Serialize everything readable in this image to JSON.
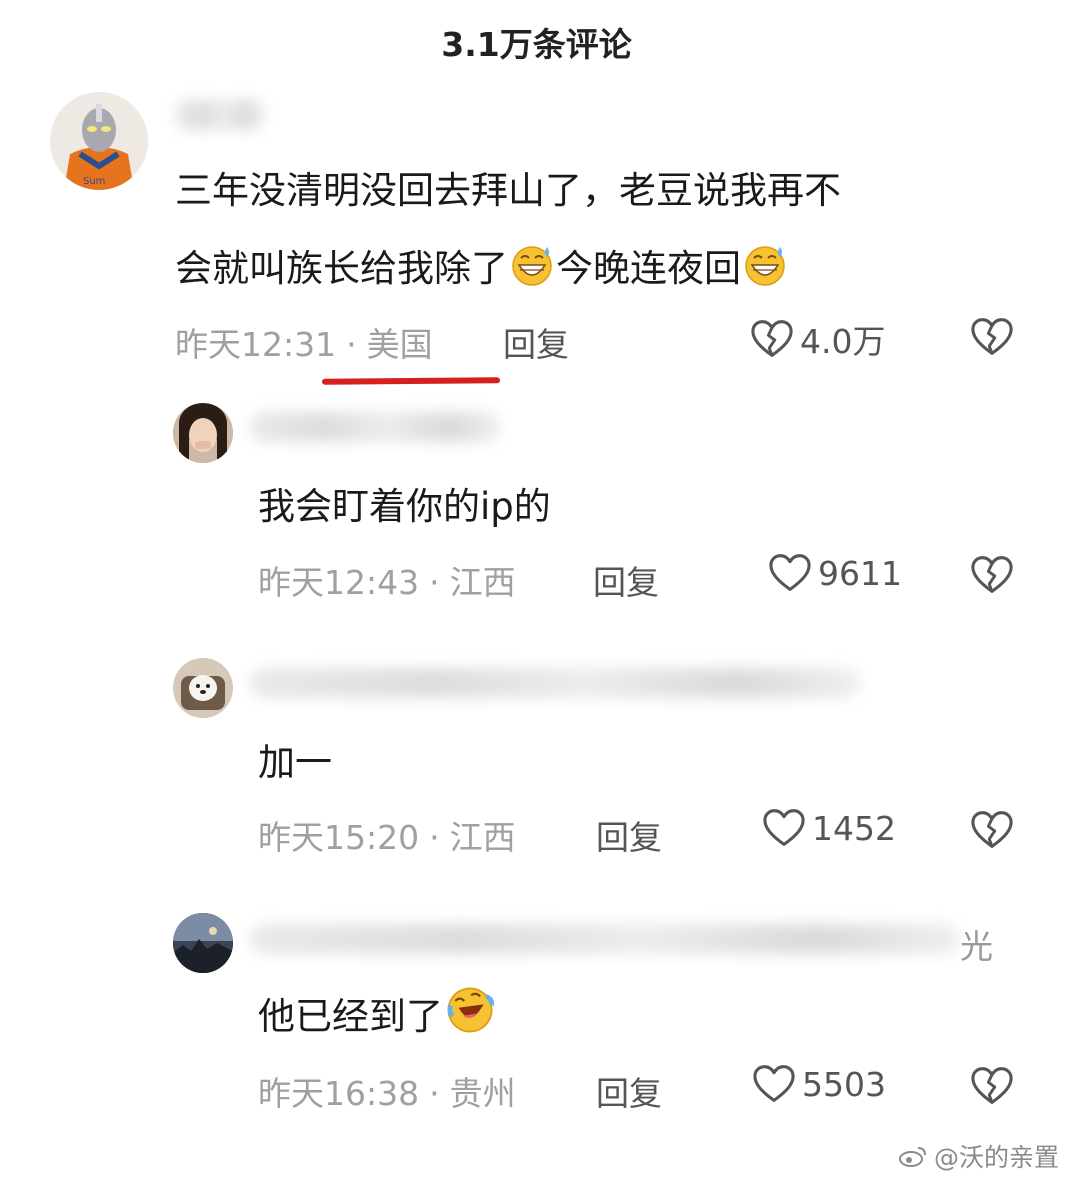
{
  "header": {
    "title": "3.1万条评论"
  },
  "comments": [
    {
      "text_lines": [
        "三年没清明没回去拜山了，老豆说我再不",
        "会就叫族长给我除了",
        "今晚连夜回"
      ],
      "time": "昨天12:31",
      "location": "美国",
      "reply": "回复",
      "likes": "4.0万"
    },
    {
      "text": "我会盯着你的ip的",
      "time": "昨天12:43",
      "location": "江西",
      "reply": "回复",
      "likes": "9611"
    },
    {
      "text": "加一",
      "time": "昨天15:20",
      "location": "江西",
      "reply": "回复",
      "likes": "1452"
    },
    {
      "text": "他已经到了",
      "time": "昨天16:38",
      "location": "贵州",
      "reply": "回复",
      "likes": "5503",
      "name_fragment": "光"
    }
  ],
  "meta_separator": "·",
  "icons": {
    "like": "heart-outline-icon",
    "dislike": "broken-heart-icon",
    "emoji_sweat": "grinning-sweat-emoji",
    "emoji_laugh": "rolling-laughing-emoji"
  },
  "colors": {
    "underline": "#d6201f",
    "meta": "#a0a0a0"
  },
  "watermark": {
    "text": "@沃的亲置"
  }
}
